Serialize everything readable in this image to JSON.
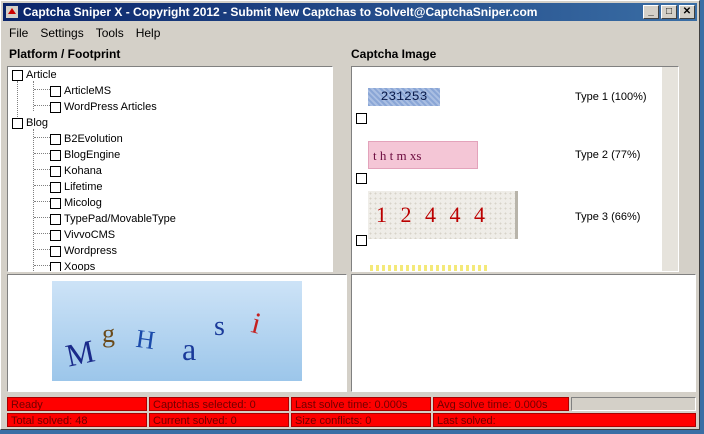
{
  "window": {
    "title": "Captcha Sniper X - Copyright 2012 - Submit New Captchas to SolveIt@CaptchaSniper.com"
  },
  "titlebar_buttons": {
    "minimize": "_",
    "maximize": "□",
    "close": "✕"
  },
  "menu": [
    "File",
    "Settings",
    "Tools",
    "Help"
  ],
  "platform_label": "Platform / Footprint",
  "captcha_label": "Captcha Image",
  "tree": {
    "article": {
      "label": "Article",
      "children": [
        "ArticleMS",
        "WordPress Articles"
      ]
    },
    "blog": {
      "label": "Blog",
      "children": [
        "B2Evolution",
        "BlogEngine",
        "Kohana",
        "Lifetime",
        "Micolog",
        "TypePad/MovableType",
        "VivvoCMS",
        "Wordpress",
        "Xoops"
      ]
    }
  },
  "captchas": [
    {
      "text": "231253",
      "type": "Type 1 (100%)"
    },
    {
      "text": "t h t  m xs",
      "type": "Type 2 (77%)"
    },
    {
      "text": "1 2 4 4 4",
      "type": "Type 3 (66%)"
    }
  ],
  "preview_captcha": {
    "letters": [
      "M",
      "g",
      "H",
      "a",
      "s",
      "i"
    ]
  },
  "status": {
    "ready": "Ready",
    "captchas_selected": "Captchas selected: 0",
    "last_solve_time": "Last solve time: 0.000s",
    "avg_solve_time": "Avg solve time: 0.000s",
    "total_solved": "Total solved: 48",
    "current_solved": "Current solved: 0",
    "size_conflicts": "Size conflicts: 0",
    "last_solved": "Last solved:"
  },
  "colors": {
    "status_red": "#ff0000",
    "title_blue": "#0a246a"
  }
}
